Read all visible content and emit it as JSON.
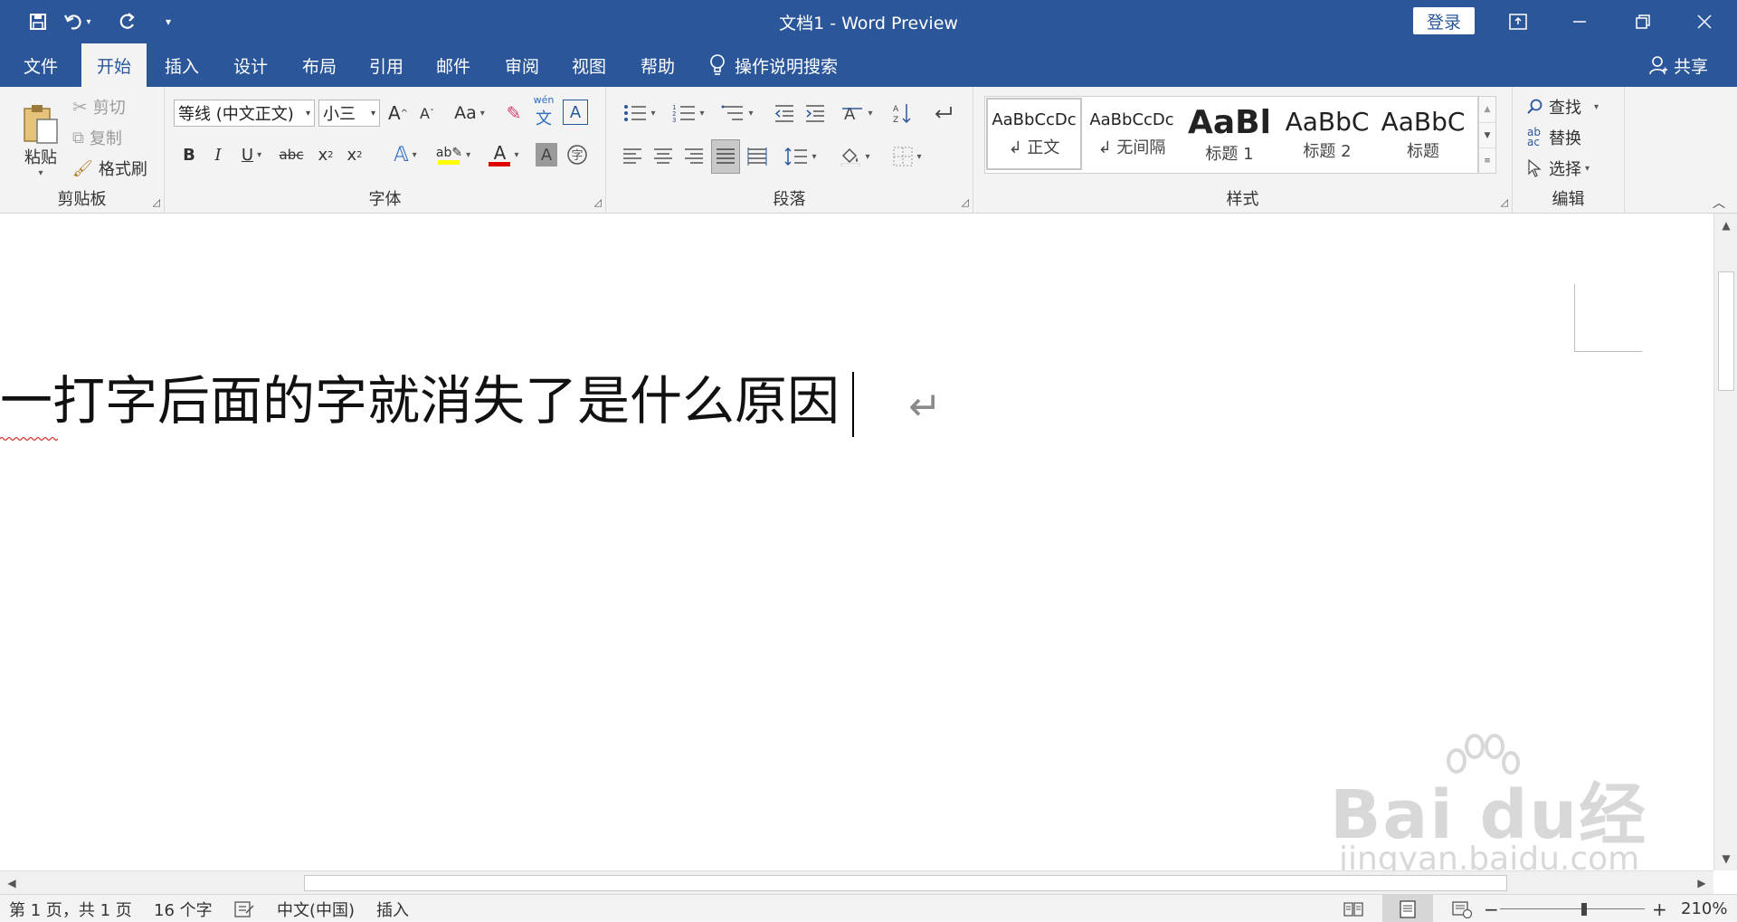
{
  "window": {
    "title": "文档1  -  Word Preview",
    "login_label": "登录"
  },
  "quick_access": {
    "save_icon": "save-icon",
    "undo_icon": "undo-icon",
    "redo_icon": "redo-icon",
    "customize_icon": "customize-qat-icon"
  },
  "tabs": [
    {
      "label": "文件"
    },
    {
      "label": "开始"
    },
    {
      "label": "插入"
    },
    {
      "label": "设计"
    },
    {
      "label": "布局"
    },
    {
      "label": "引用"
    },
    {
      "label": "邮件"
    },
    {
      "label": "审阅"
    },
    {
      "label": "视图"
    },
    {
      "label": "帮助"
    }
  ],
  "active_tab": "开始",
  "tell_me": "操作说明搜索",
  "share": "共享",
  "ribbon": {
    "clipboard": {
      "paste": "粘贴",
      "cut": "剪切",
      "copy": "复制",
      "format_painter": "格式刷",
      "label": "剪贴板"
    },
    "font": {
      "font_name": "等线 (中文正文)",
      "font_size": "小三",
      "label": "字体",
      "grow": "A",
      "shrink": "A",
      "change_case": "Aa",
      "bold": "B",
      "italic": "I",
      "underline": "U",
      "strike": "abc",
      "subscript": "x",
      "superscript": "x",
      "highlight_color": "#ffff00",
      "font_color": "#e00000"
    },
    "paragraph": {
      "label": "段落"
    },
    "styles": {
      "label": "样式",
      "items": [
        {
          "preview": "AaBbCcDc",
          "name": "↲ 正文"
        },
        {
          "preview": "AaBbCcDc",
          "name": "↲ 无间隔"
        },
        {
          "preview": "AaBl",
          "name": "标题 1"
        },
        {
          "preview": "AaBbC",
          "name": "标题 2"
        },
        {
          "preview": "AaBbC",
          "name": "标题"
        }
      ]
    },
    "editing": {
      "find": "查找",
      "replace": "替换",
      "select": "选择",
      "label": "编辑"
    }
  },
  "document": {
    "text": "一打字后面的字就消失了是什么原因",
    "paragraph_mark": "↵"
  },
  "watermark": {
    "logo": "Bai du经验",
    "url": "jingyan.baidu.com"
  },
  "status": {
    "page": "第 1 页，共 1 页",
    "words": "16 个字",
    "language": "中文(中国)",
    "mode": "插入",
    "zoom": "210%",
    "zoom_level": 0.58
  }
}
